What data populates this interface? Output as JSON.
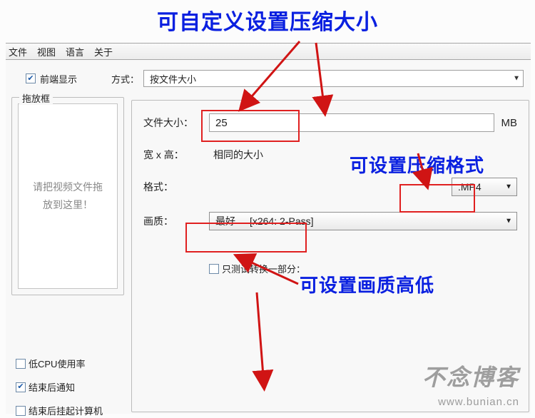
{
  "annotations": {
    "top": "可自定义设置压缩大小",
    "format": "可设置压缩格式",
    "quality": "可设置画质高低"
  },
  "menu": [
    "文件",
    "视图",
    "语言",
    "关于"
  ],
  "header": {
    "front_display": "前端显示",
    "mode_label": "方式：",
    "mode_value": "按文件大小"
  },
  "left": {
    "group_title": "拖放框",
    "drop_hint_l1": "请把视频文件拖",
    "drop_hint_l2": "放到这里！",
    "opts": {
      "low_cpu": "低CPU使用率",
      "notify": "结束后通知",
      "suspend": "结束后挂起计算机"
    }
  },
  "right": {
    "size_label": "文件大小：",
    "size_value": "25",
    "size_unit": "MB",
    "wh_label": "宽 x 高：",
    "wh_value": "相同的大小",
    "format_label": "格式：",
    "format_value": ".MP4",
    "quality_label": "画质：",
    "quality_v1": "最好",
    "quality_v2": "[x264: 2-Pass]",
    "test_label": "只测试转换一部分："
  },
  "watermark": {
    "logo": "不念博客",
    "url": "www.bunian.cn"
  }
}
